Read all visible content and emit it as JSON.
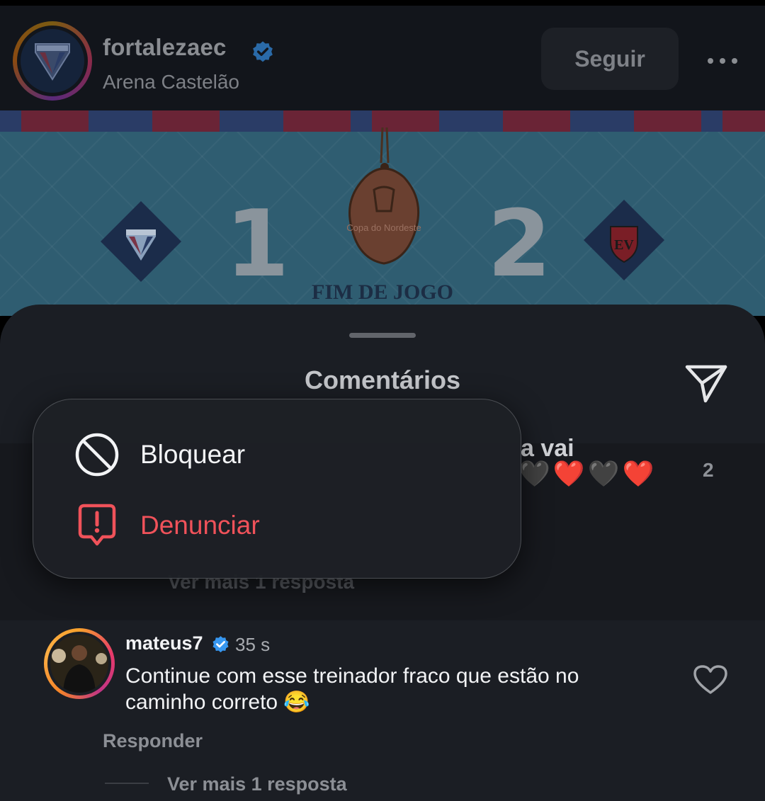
{
  "header": {
    "account_name": "fortalezaec",
    "location": "Arena Castelão",
    "follow_label": "Seguir",
    "more_icon": "more-horizontal-icon"
  },
  "post": {
    "home_score": "1",
    "away_score": "2",
    "status_label": "FIM DE JOGO",
    "trophy_caption": "Copa do Nordeste"
  },
  "sheet": {
    "title": "Comentários",
    "share_icon": "send-icon"
  },
  "comment_1": {
    "visible_tail": "a vai",
    "emojis": "🖤❤️🖤❤️",
    "like_count": "2",
    "more_replies": "Ver mais 1 resposta"
  },
  "context_menu": {
    "block_label": "Bloquear",
    "block_icon": "block-icon",
    "report_label": "Denunciar",
    "report_icon": "report-icon",
    "report_color": "#f0525a"
  },
  "comment_2": {
    "username": "mateus7",
    "time": "35 s",
    "text": "Continue com esse treinador fraco que estão no caminho correto 😂",
    "reply_label": "Responder",
    "more_replies": "Ver mais 1 resposta"
  },
  "colors": {
    "verified_blue": "#3797f0",
    "sheet_bg": "#1b1e24"
  }
}
